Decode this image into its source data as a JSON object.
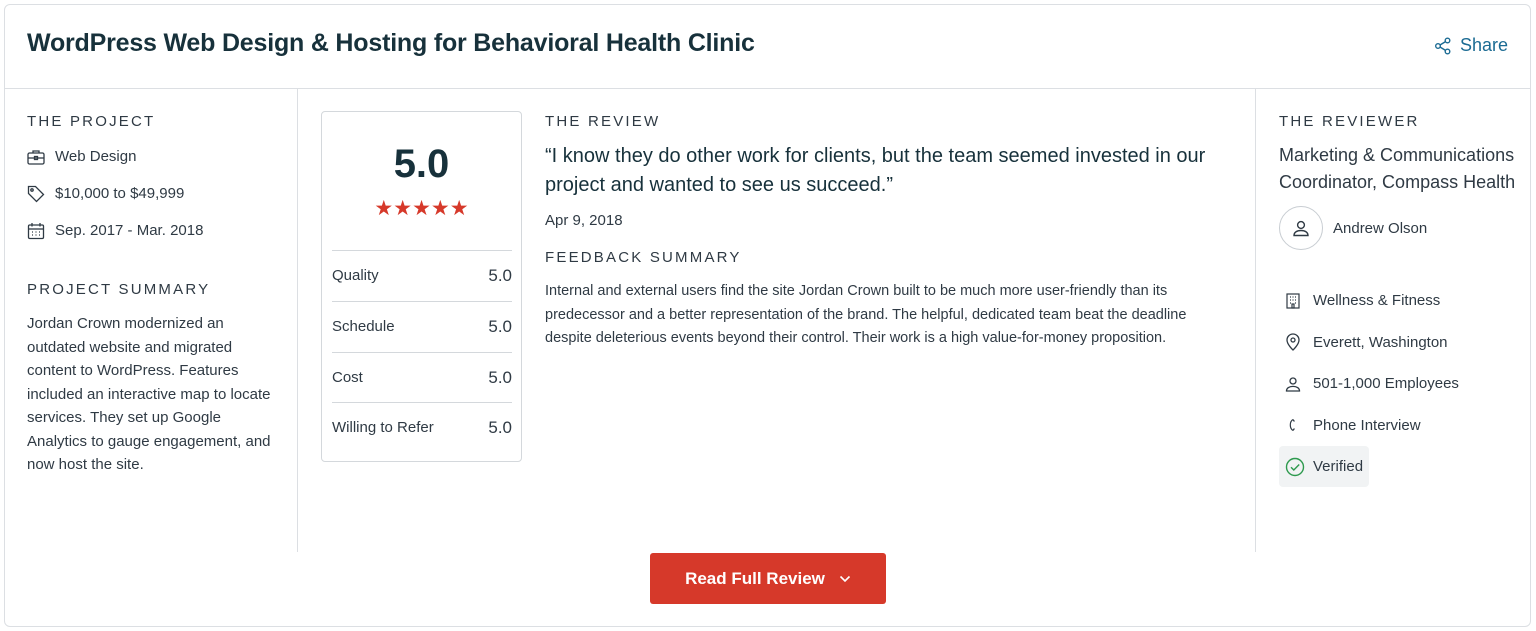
{
  "header": {
    "title": "WordPress Web Design & Hosting for Behavioral Health Clinic",
    "share_label": "Share"
  },
  "project": {
    "section_label": "THE PROJECT",
    "service": "Web Design",
    "budget": "$10,000 to $49,999",
    "dates": "Sep. 2017 - Mar. 2018",
    "summary_label": "PROJECT SUMMARY",
    "summary": "Jordan Crown modernized an outdated website and migrated content to WordPress. Features included an interactive map to locate services. They set up Google Analytics to gauge engagement, and now host the site."
  },
  "rating": {
    "overall": "5.0",
    "stars": 5,
    "accent": "#d6392a",
    "rows": [
      {
        "label": "Quality",
        "value": "5.0"
      },
      {
        "label": "Schedule",
        "value": "5.0"
      },
      {
        "label": "Cost",
        "value": "5.0"
      },
      {
        "label": "Willing to Refer",
        "value": "5.0"
      }
    ]
  },
  "review": {
    "section_label": "THE REVIEW",
    "quote": "“I know they do other work for clients, but the team seemed invested in our project and wanted to see us succeed.”",
    "date": "Apr 9, 2018",
    "feedback_label": "FEEDBACK SUMMARY",
    "feedback": "Internal and external users find the site Jordan Crown built to be much more user-friendly than its predecessor and a better representation of the brand. The helpful, dedicated team beat the deadline despite deleterious events beyond their control. Their work is a high value-for-money proposition."
  },
  "reviewer": {
    "section_label": "THE REVIEWER",
    "role": "Marketing & Communications Coordinator, Compass Health",
    "name": "Andrew Olson",
    "industry": "Wellness & Fitness",
    "location": "Everett, Washington",
    "size": "501-1,000 Employees",
    "review_type": "Phone Interview",
    "verified": "Verified"
  },
  "cta": {
    "read_full_review": "Read Full Review"
  }
}
